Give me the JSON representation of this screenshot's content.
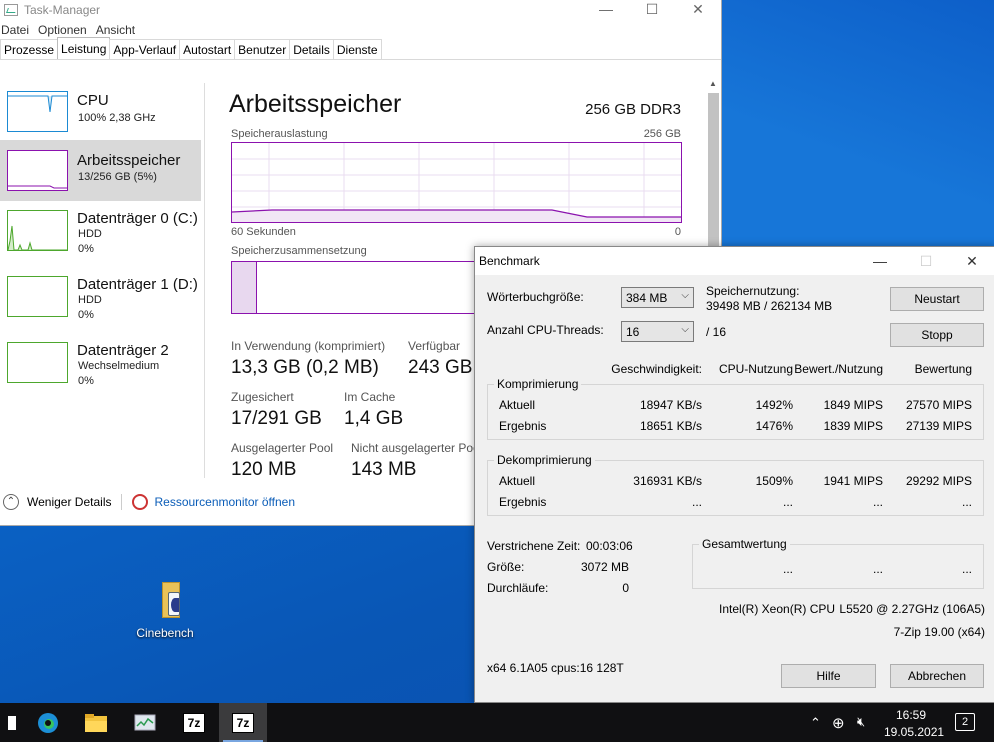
{
  "taskmanager": {
    "title": "Task-Manager",
    "window_buttons": [
      "—",
      "☐",
      "✕"
    ],
    "menu": [
      "Datei",
      "Optionen",
      "Ansicht"
    ],
    "tabs": [
      "Prozesse",
      "Leistung",
      "App-Verlauf",
      "Autostart",
      "Benutzer",
      "Details",
      "Dienste"
    ],
    "active_tab": "Leistung",
    "sidebar": [
      {
        "name": "CPU",
        "sub1": "100%  2,38 GHz",
        "sub2": "",
        "sub3": "",
        "color": "#1b8ad3"
      },
      {
        "name": "Arbeitsspeicher",
        "sub1": "13/256 GB (5%)",
        "sub2": "",
        "sub3": "",
        "color": "#8b12ae"
      },
      {
        "name": "Datenträger 0 (C:)",
        "sub1": "HDD",
        "sub2": "0%",
        "sub3": "",
        "color": "#4da72d"
      },
      {
        "name": "Datenträger 1 (D:)",
        "sub1": "HDD",
        "sub2": "0%",
        "sub3": "",
        "color": "#4da72d"
      },
      {
        "name": "Datenträger 2",
        "sub1": "Wechselmedium",
        "sub2": "0%",
        "sub3": "",
        "color": "#4da72d"
      }
    ],
    "main": {
      "title": "Arbeitsspeicher",
      "type": "256 GB DDR3",
      "usage_label": "Speicherauslastung",
      "usage_max": "256 GB",
      "time_label": "60 Sekunden",
      "zero": "0",
      "composition_label": "Speicherzusammensetzung",
      "stats": {
        "in_use_label": "In Verwendung (komprimiert)",
        "in_use": "13,3 GB (0,2 MB)",
        "avail_label": "Verfügbar",
        "avail": "243 GB",
        "committed_label": "Zugesichert",
        "committed": "17/291 GB",
        "cached_label": "Im Cache",
        "cached": "1,4 GB",
        "paged_label": "Ausgelagerter Pool",
        "paged": "120 MB",
        "nonpaged_label": "Nicht ausgelagerter Pool",
        "nonpaged": "143 MB"
      }
    },
    "footer": {
      "less_details": "Weniger Details",
      "resmon": "Ressourcenmonitor öffnen"
    }
  },
  "benchmark": {
    "title": "Benchmark",
    "dict_label": "Wörterbuchgröße:",
    "dict_value": "384 MB",
    "threads_label": "Anzahl CPU-Threads:",
    "threads_value": "16",
    "threads_total": "/ 16",
    "mem_label": "Speichernutzung:",
    "mem_value": "39498 MB / 262134 MB",
    "restart": "Neustart",
    "stop": "Stopp",
    "headers": [
      "Geschwindigkeit:",
      "CPU-Nutzung",
      "Bewert./Nutzung",
      "Bewertung"
    ],
    "compress_title": "Komprimierung",
    "compress_rows": [
      {
        "label": "Aktuell",
        "speed": "18947 KB/s",
        "cpu": "1492%",
        "rpu": "1849 MIPS",
        "rating": "27570 MIPS"
      },
      {
        "label": "Ergebnis",
        "speed": "18651 KB/s",
        "cpu": "1476%",
        "rpu": "1839 MIPS",
        "rating": "27139 MIPS"
      }
    ],
    "decompress_title": "Dekomprimierung",
    "decompress_rows": [
      {
        "label": "Aktuell",
        "speed": "316931 KB/s",
        "cpu": "1509%",
        "rpu": "1941 MIPS",
        "rating": "29292 MIPS"
      },
      {
        "label": "Ergebnis",
        "speed": "...",
        "cpu": "...",
        "rpu": "...",
        "rating": "..."
      }
    ],
    "elapsed_label": "Verstrichene Zeit:",
    "elapsed": "00:03:06",
    "size_label": "Größe:",
    "size": "3072 MB",
    "passes_label": "Durchläufe:",
    "passes": "0",
    "total_title": "Gesamtwertung",
    "total_vals": [
      "...",
      "...",
      "..."
    ],
    "cpu_name": "Intel(R) Xeon(R) CPU",
    "cpu_model": "L5520  @ 2.27GHz (106A5)",
    "version": "7-Zip 19.00 (x64)",
    "sysinfo": "x64 6.1A05 cpus:16 128T",
    "help": "Hilfe",
    "cancel": "Abbrechen"
  },
  "desktop": {
    "icon_label": "Cinebench"
  },
  "taskbar": {
    "time": "16:59",
    "date": "19.05.2021",
    "notif_count": "2",
    "app_label": "7z"
  }
}
